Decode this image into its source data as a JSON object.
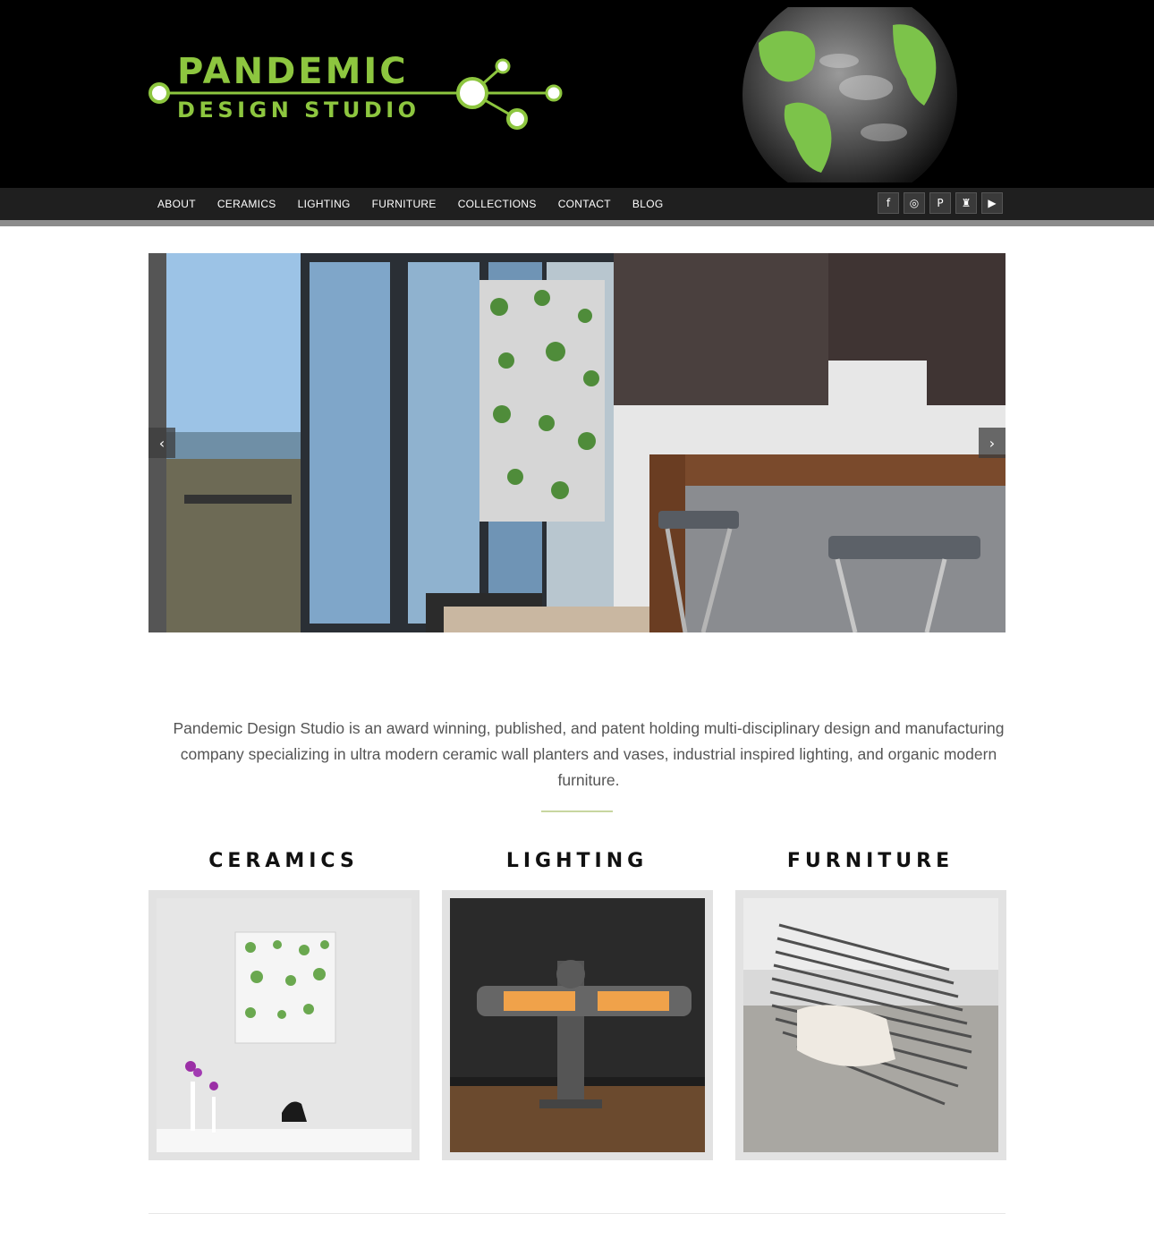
{
  "brand": {
    "line1": "PANDEMIC",
    "line2": "DESIGN STUDIO",
    "accent_color": "#8dc63f"
  },
  "nav": {
    "items": [
      {
        "label": "ABOUT"
      },
      {
        "label": "CERAMICS"
      },
      {
        "label": "LIGHTING"
      },
      {
        "label": "FURNITURE"
      },
      {
        "label": "COLLECTIONS"
      },
      {
        "label": "CONTACT"
      },
      {
        "label": "BLOG"
      }
    ],
    "socials": [
      {
        "icon": "facebook-icon",
        "glyph": "f"
      },
      {
        "icon": "instagram-icon",
        "glyph": "◎"
      },
      {
        "icon": "pinterest-icon",
        "glyph": "P"
      },
      {
        "icon": "houzz-icon",
        "glyph": "♜"
      },
      {
        "icon": "youtube-icon",
        "glyph": "▶"
      }
    ]
  },
  "slider": {
    "prev_glyph": "‹",
    "next_glyph": "›"
  },
  "intro": {
    "text": "Pandemic Design Studio is an award winning, published, and patent holding multi-disciplinary design and manufacturing company specializing in ultra modern ceramic wall planters and vases, industrial inspired lighting, and organic modern furniture."
  },
  "categories": [
    {
      "title": "CERAMICS"
    },
    {
      "title": "LIGHTING"
    },
    {
      "title": "FURNITURE"
    }
  ]
}
